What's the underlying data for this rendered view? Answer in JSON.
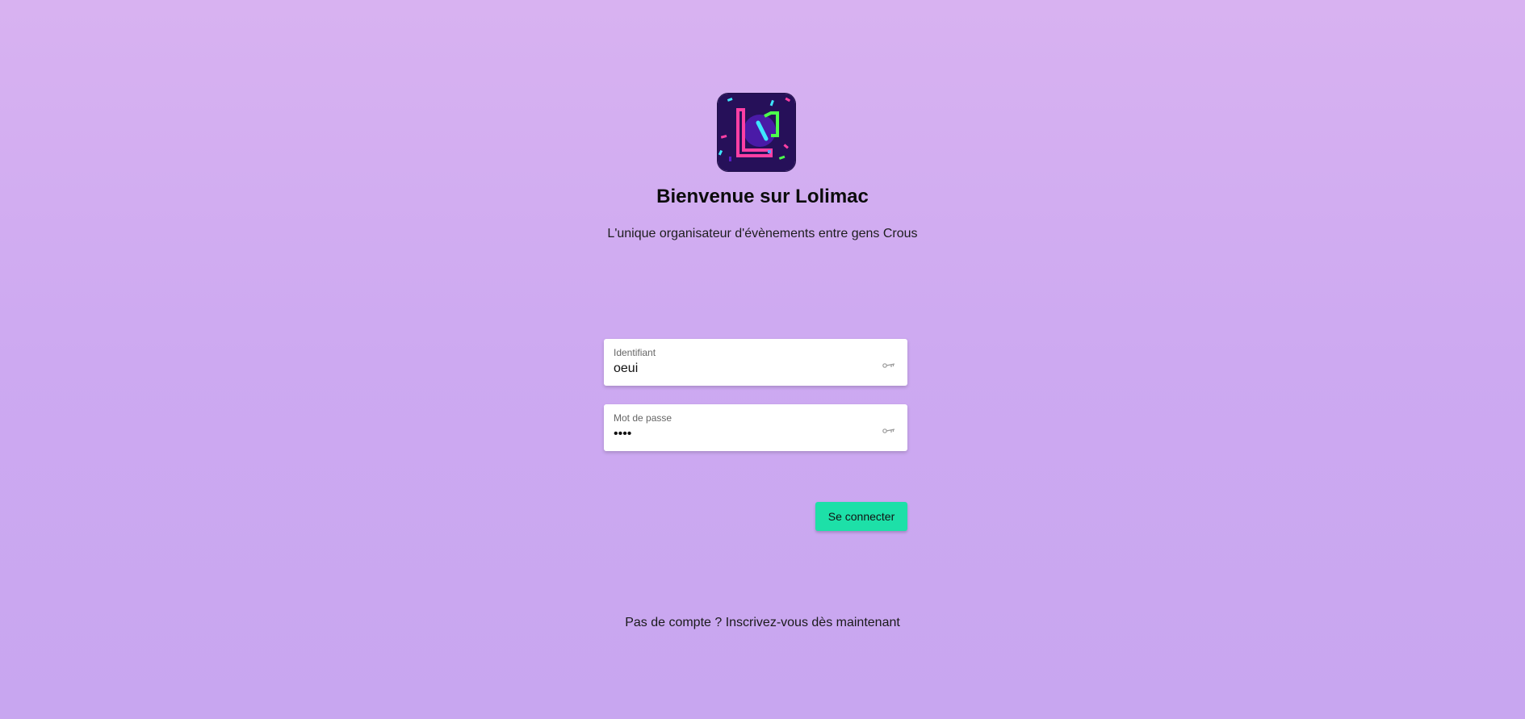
{
  "header": {
    "title": "Bienvenue sur Lolimac",
    "subtitle": "L'unique organisateur d'évènements entre gens Crous"
  },
  "logo": {
    "icon": "lolimac-logo",
    "colors": {
      "background": "#261059",
      "letter_l": "#ff3fa4",
      "accent_green": "#4cff4c",
      "accent_cyan": "#3ee7ff"
    }
  },
  "form": {
    "username": {
      "label": "Identifiant",
      "value": "oeui",
      "icon": "key-icon"
    },
    "password": {
      "label": "Mot de passe",
      "value": "••••",
      "icon": "key-icon"
    },
    "submit_label": "Se connecter"
  },
  "footer": {
    "signup_prompt": "Pas de compte ? ",
    "signup_link": "Inscrivez-vous dès maintenant"
  },
  "colors": {
    "button": "#1de0a8",
    "background_top": "#d8b2f1",
    "background_bottom": "#c8a6f0"
  }
}
